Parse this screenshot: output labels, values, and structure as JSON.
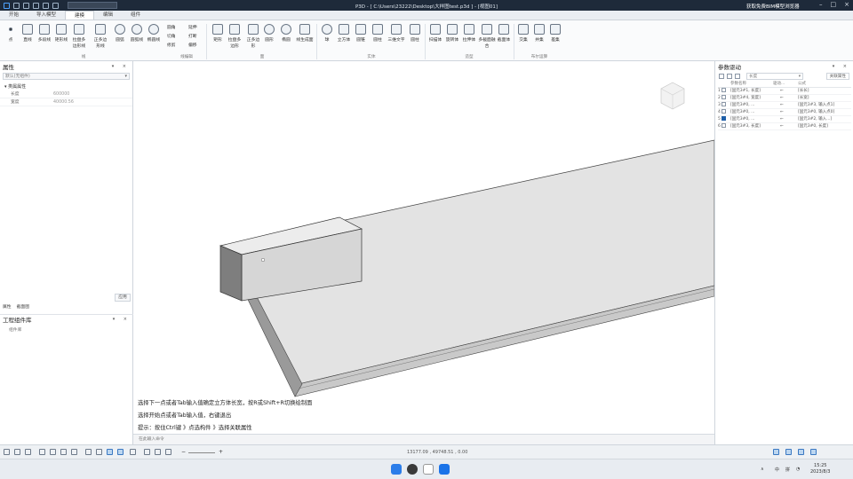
{
  "titlebar": {
    "title": "P3D - [ C:\\Users\\23222\\Desktop\\大样图test.p3d ] - [视图01]",
    "promo": "获取免费BIM模型浏览器"
  },
  "menu": {
    "tabs": [
      "开始",
      "导入模型",
      "建模",
      "编辑",
      "组件"
    ],
    "active": "建模"
  },
  "ribbon": {
    "buttons": [
      "点",
      "直线",
      "多段线",
      "矩形线",
      "拉盘多边形线",
      "正多边形线",
      "圆弧",
      "圆弧线",
      "椭圆线",
      "矩形",
      "拉盘多边形",
      "正多边形",
      "圆形",
      "椭圆",
      "线生成面",
      "球",
      "立方体",
      "圆锥",
      "圆柱",
      "三维文字",
      "圆柱",
      "扫描体",
      "旋转体",
      "拉伸体",
      "多截面融合",
      "截面体",
      "交集",
      "并集",
      "差集"
    ],
    "small_tools": [
      "圆角",
      "切角",
      "修剪",
      "延伸",
      "打断",
      "偏移"
    ],
    "groups": [
      "线",
      "线编辑",
      "面",
      "实体",
      "造型",
      "布尔运算"
    ]
  },
  "left_panel": {
    "title": "属性",
    "combo": "默认(无组件)",
    "group": "类属属性",
    "props": [
      {
        "k": "长度",
        "v": "600000"
      },
      {
        "k": "宽度",
        "v": "40000.56"
      }
    ],
    "ok": "应用",
    "tabs": [
      "属性",
      "截面图"
    ],
    "lib_title": "工程组件库",
    "lib_item": "组件库"
  },
  "viewport": {
    "prompts": [
      "选择下一点或者Tab输入值确定立方体长宽，按R或Shift+R切换绘制面",
      "选择开始点或者Tab输入值，右键退出",
      "提示：按住Ctrl键 》点选构件 》选择关联属性"
    ]
  },
  "cmdline": {
    "placeholder": "在此输入命令"
  },
  "right_panel": {
    "title": "参数驱动",
    "combo": "长度",
    "button": "关联属性",
    "columns": [
      "",
      "参数名称",
      "驱动...",
      "公式"
    ],
    "rows": [
      {
        "n": "1",
        "checked": false,
        "name": "[固元3#1, 长度]",
        "formula": "[长长]"
      },
      {
        "n": "2",
        "checked": false,
        "name": "[固元3#4, 宽度]",
        "formula": "[长宽]"
      },
      {
        "n": "3",
        "checked": false,
        "name": "[固元3#0, ...",
        "formula": "[固元3#3, 输入点1]"
      },
      {
        "n": "4",
        "checked": false,
        "name": "[固元3#0, ...",
        "formula": "[固元3#0, 输入点0]"
      },
      {
        "n": "5",
        "checked": true,
        "name": "[固元3#0, ...",
        "formula": "[固元3#2, 输入...]"
      },
      {
        "n": "6",
        "checked": false,
        "name": "[固元3#3, 长度]",
        "formula": "[固元3#0, 长度]"
      }
    ]
  },
  "status": {
    "coords": "13177.09 , 49748.51 , 0.00"
  },
  "taskbar": {
    "tray": [
      "中",
      "拼"
    ],
    "time": "15:25",
    "date": "2023/8/3"
  },
  "colors": {
    "accent": "#1f5fa8",
    "titlebar": "#1e2a3a",
    "model_top": "#dcdcdc",
    "model_side": "#b4b4b4"
  }
}
